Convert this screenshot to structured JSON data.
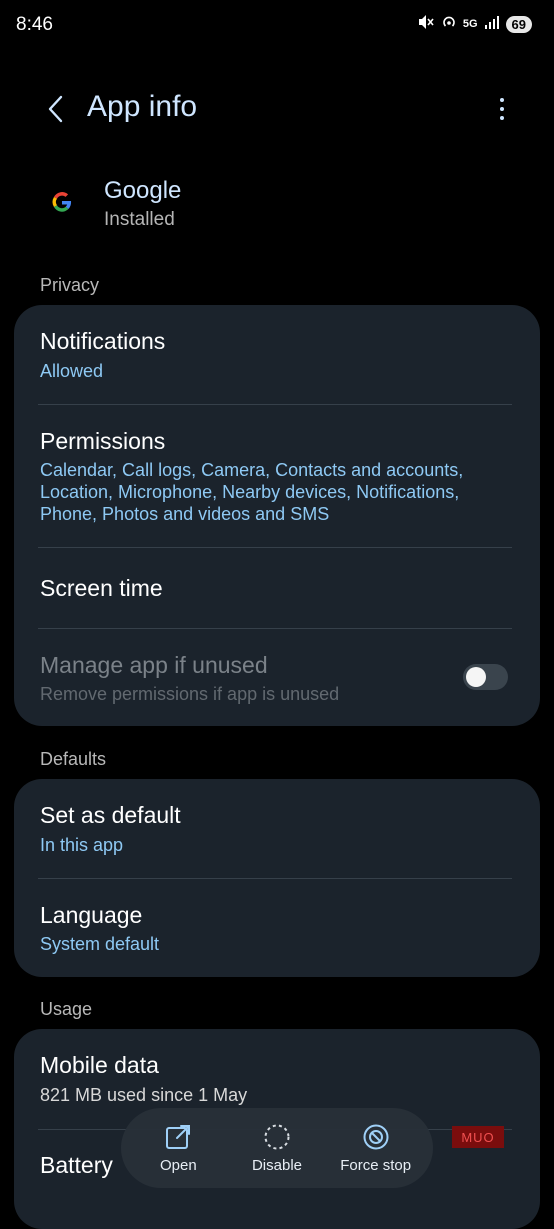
{
  "status_bar": {
    "time": "8:46",
    "network": "5G",
    "battery": "69"
  },
  "header": {
    "title": "App info"
  },
  "app": {
    "name": "Google",
    "status": "Installed"
  },
  "sections": {
    "privacy": "Privacy",
    "defaults": "Defaults",
    "usage": "Usage"
  },
  "privacy": {
    "notifications": {
      "title": "Notifications",
      "value": "Allowed"
    },
    "permissions": {
      "title": "Permissions",
      "lines": [
        "Calendar, Call logs, Camera, Contacts and accounts,",
        "Location, Microphone, Nearby devices, Notifications,",
        "Phone, Photos and videos and SMS"
      ]
    },
    "screen_time": {
      "title": "Screen time"
    },
    "manage_unused": {
      "title": "Manage app if unused",
      "value": "Remove permissions if app is unused",
      "enabled": false
    }
  },
  "defaults": {
    "set_default": {
      "title": "Set as default",
      "value": "In this app"
    },
    "language": {
      "title": "Language",
      "value": "System default"
    }
  },
  "usage": {
    "mobile_data": {
      "title": "Mobile data",
      "value": "821 MB used since 1 May"
    },
    "battery": {
      "title": "Battery"
    }
  },
  "actions": {
    "open": "Open",
    "disable": "Disable",
    "force_stop": "Force stop"
  },
  "watermark": "MUO",
  "colors": {
    "accent_text": "#8ec9f4",
    "title_text": "#cfe6ff",
    "card_bg": "#1b232c"
  }
}
